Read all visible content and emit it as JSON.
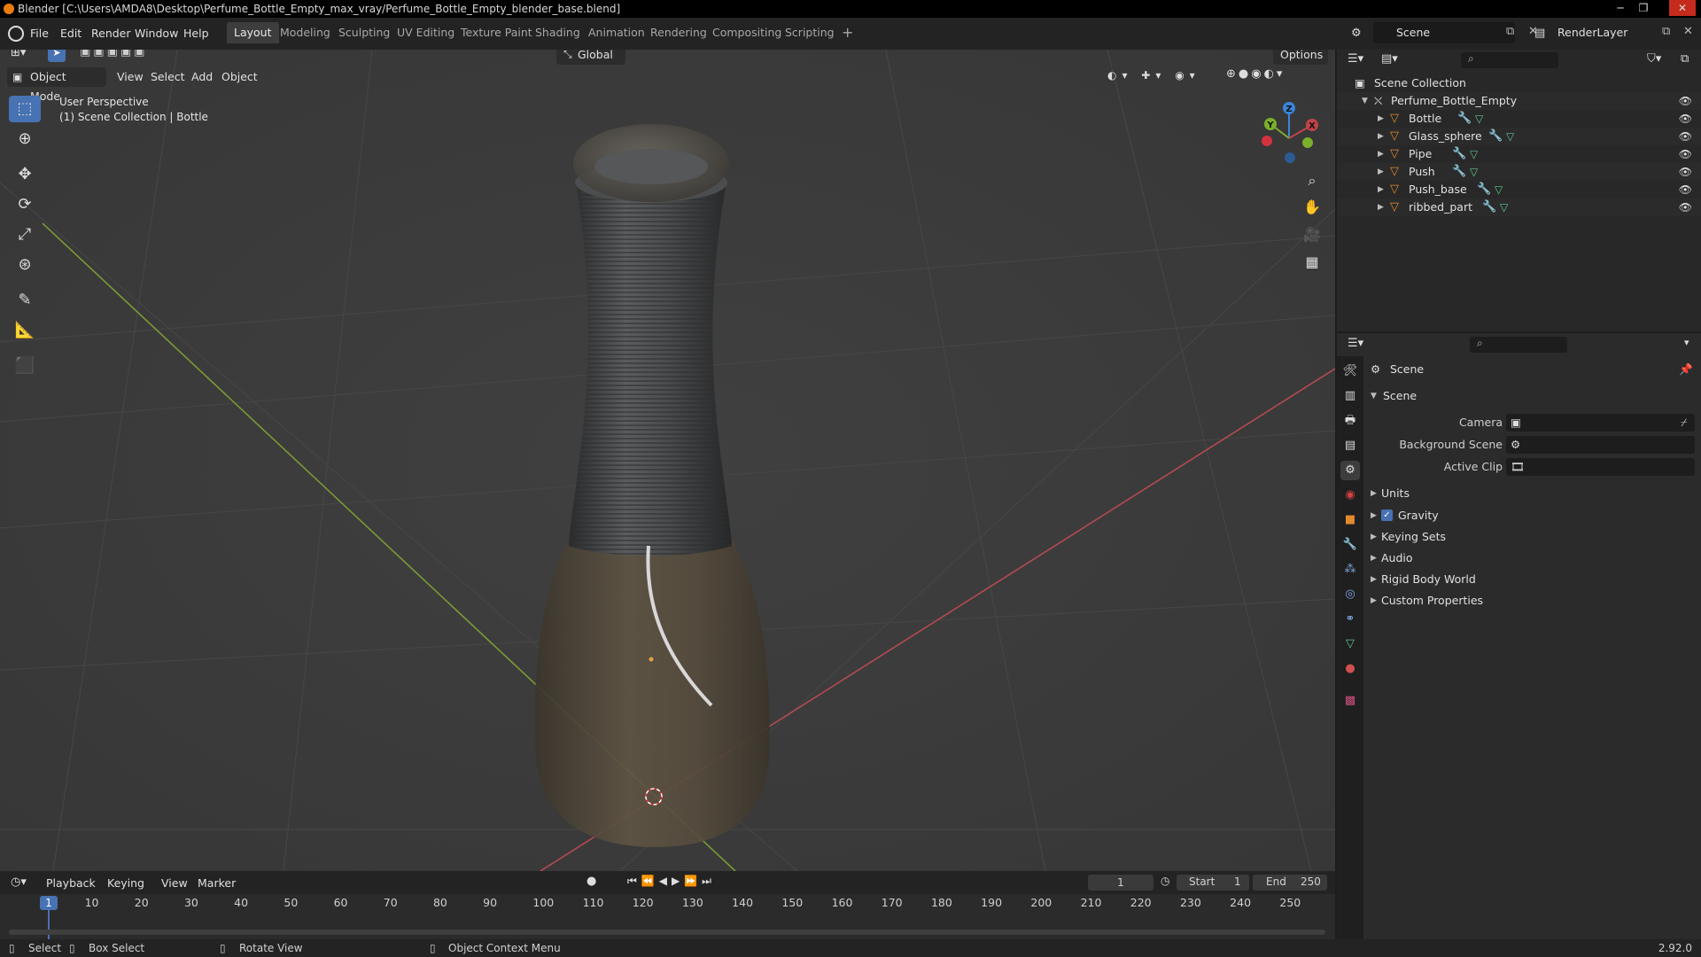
{
  "window": {
    "title": "Blender [C:\\Users\\AMDA8\\Desktop\\Perfume_Bottle_Empty_max_vray/Perfume_Bottle_Empty_blender_base.blend]",
    "controls": [
      "─",
      "❐",
      "✕"
    ]
  },
  "menu": [
    "File",
    "Edit",
    "Render",
    "Window",
    "Help"
  ],
  "workspaces": [
    "Layout",
    "Modeling",
    "Sculpting",
    "UV Editing",
    "Texture Paint",
    "Shading",
    "Animation",
    "Rendering",
    "Compositing",
    "Scripting",
    "+"
  ],
  "active_workspace": "Layout",
  "scene_selector": "Scene",
  "render_layer": "RenderLayer",
  "viewport_header": {
    "mode": "Object Mode",
    "menus": [
      "View",
      "Select",
      "Add",
      "Object"
    ],
    "orientation": "Global",
    "options": "Options"
  },
  "viewport": {
    "line1": "User Perspective",
    "line2": "(1) Scene Collection | Bottle",
    "gizmo": {
      "z": "Z",
      "y": "Y",
      "x": "X"
    },
    "background": "#3d3d3d"
  },
  "outliner": {
    "root": "Scene Collection",
    "collection": "Perfume_Bottle_Empty",
    "objects": [
      "Bottle",
      "Glass_sphere",
      "Pipe",
      "Push",
      "Push_base",
      "ribbed_part"
    ]
  },
  "properties": {
    "header": "Scene",
    "panel": "Scene",
    "fields": [
      {
        "label": "Camera"
      },
      {
        "label": "Background Scene"
      },
      {
        "label": "Active Clip"
      }
    ],
    "sections": [
      "Units",
      "Gravity",
      "Keying Sets",
      "Audio",
      "Rigid Body World",
      "Custom Properties"
    ],
    "gravity_checked": true
  },
  "timeline": {
    "menus": [
      "Playback",
      "Keying",
      "View",
      "Marker"
    ],
    "current_frame": "1",
    "start_label": "Start",
    "start": "1",
    "end_label": "End",
    "end": "250",
    "ticks": [
      "1",
      "10",
      "20",
      "30",
      "40",
      "50",
      "60",
      "70",
      "80",
      "90",
      "100",
      "110",
      "120",
      "130",
      "140",
      "150",
      "160",
      "170",
      "180",
      "190",
      "200",
      "210",
      "220",
      "230",
      "240",
      "250"
    ]
  },
  "statusbar": {
    "select": "Select",
    "box_select": "Box Select",
    "rotate": "Rotate View",
    "context": "Object Context Menu",
    "version": "2.92.0"
  },
  "colors": {
    "accent": "#4772b3",
    "orange": "#e87d0d",
    "axis_x": "#c4424a",
    "axis_y": "#7bb02b",
    "axis_z": "#3a86d8"
  },
  "icons": [
    "blender-logo-icon",
    "select-tool-icon",
    "cursor-icon",
    "move-icon",
    "rotate-icon",
    "scale-icon",
    "transform-icon",
    "annotate-icon",
    "measure-icon",
    "add-cube-icon",
    "zoom-icon",
    "hand-icon",
    "camera-icon",
    "grid-icon",
    "eye-icon",
    "wrench-icon",
    "mesh-icon",
    "search-icon",
    "filter-icon",
    "play-icon"
  ]
}
